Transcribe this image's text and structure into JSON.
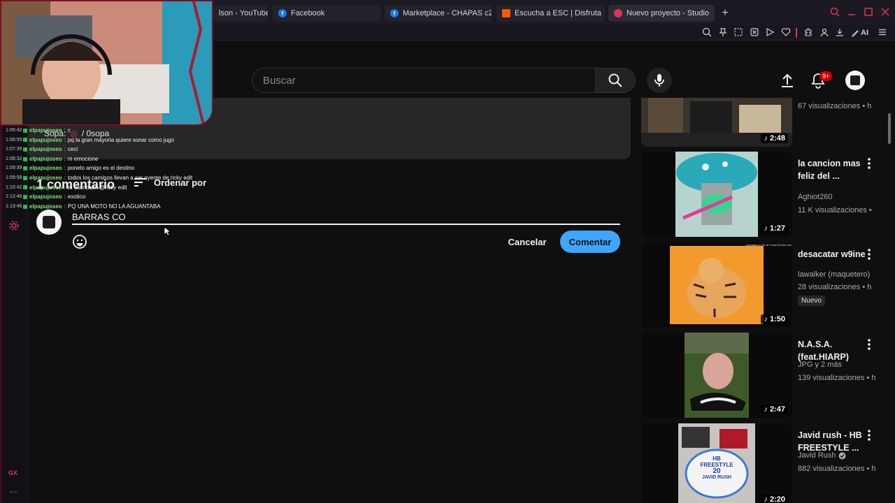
{
  "browser": {
    "tabs": [
      {
        "label": "lson - YouTube",
        "icon": "youtube-icon",
        "color": "#ff0000"
      },
      {
        "label": "Facebook",
        "icon": "facebook-icon",
        "color": "#1877f2"
      },
      {
        "label": "Marketplace - CHAPAS c2",
        "icon": "facebook-icon",
        "color": "#1877f2"
      },
      {
        "label": "Escucha a ESC | Disfruta",
        "icon": "soundcloud-icon",
        "color": "#ff5500"
      },
      {
        "label": "Nuevo proyecto - Studio",
        "icon": "studio-icon",
        "color": "#e0325a"
      }
    ],
    "new_tab": "+",
    "ai_label": "AI"
  },
  "gx_sidebar": {
    "label": "GX",
    "more": "…"
  },
  "header": {
    "search_placeholder": "Buscar",
    "notification_count": "9+"
  },
  "comments": {
    "count_label": "1 comentario",
    "sort_label": "Ordenar por",
    "draft_text": "BARRAS CO",
    "cancel_label": "Cancelar",
    "submit_label": "Comentar"
  },
  "overlay_author": {
    "name": "Sopa:",
    "handle": "/ 0sopa"
  },
  "chat": [
    {
      "time": "1:06:42",
      "user": "elpapujoseo",
      "msg": "c"
    },
    {
      "time": "1:06:55",
      "user": "elpapujoseo",
      "msg": "pq la gran mayoria quiere sonar como jugo"
    },
    {
      "time": "1:07:39",
      "user": "elpapujoseo",
      "msg": "ceci"
    },
    {
      "time": "1:08:32",
      "user": "elpapujoseo",
      "msg": "m emocione"
    },
    {
      "time": "1:09:39",
      "user": "elpapujoseo",
      "msg": "ponelo amigo es el destino"
    },
    {
      "time": "1:09:58",
      "user": "elpapujoseo",
      "msg": "todos los caminos llevan a ser oyente de ricky edit"
    },
    {
      "time": "1:10:42",
      "user": "elpapujoseo",
      "msg": "te escribiste @ricky edit"
    },
    {
      "time": "1:12:46",
      "user": "elpapujoseo",
      "msg": "exotico"
    },
    {
      "time": "1:13:46",
      "user": "elpapujoseo",
      "msg": "PQ UNA MOTO NO LA AGUANTABA"
    }
  ],
  "recommendations": [
    {
      "title": "",
      "channel": "",
      "views": "67 visualizaciones • h",
      "duration": "2:48",
      "badge": ""
    },
    {
      "title": "la cancion mas feliz del ...",
      "channel": "Aghiot260",
      "views": "11 K visualizaciones •",
      "duration": "1:27",
      "badge": ""
    },
    {
      "title": "desacatar w9ine",
      "channel": "lawalker (maquetero)",
      "views": "28 visualizaciones • h",
      "duration": "1:50",
      "badge": "Nuevo"
    },
    {
      "title": "N.A.S.A. (feat.HIARP)",
      "channel": "JPG y 2 más",
      "views": "139 visualizaciones • h",
      "duration": "2:47",
      "badge": ""
    },
    {
      "title": "Javid rush - HB FREESTYLE ...",
      "channel": "Javid Rush",
      "views": "882 visualizaciones • h",
      "duration": "2:20",
      "badge": ""
    }
  ],
  "thumb_texts": {
    "tiger_caption": "uploaded in HD at TunesToTube.com",
    "cake_line1": "HB",
    "cake_line2": "FREESTYLE",
    "cake_line3": "20",
    "cake_line4": "JAVID RUSH"
  },
  "colors": {
    "accent": "#3ea6ff",
    "gx_accent": "#e0325a",
    "notification": "#cc0000"
  }
}
